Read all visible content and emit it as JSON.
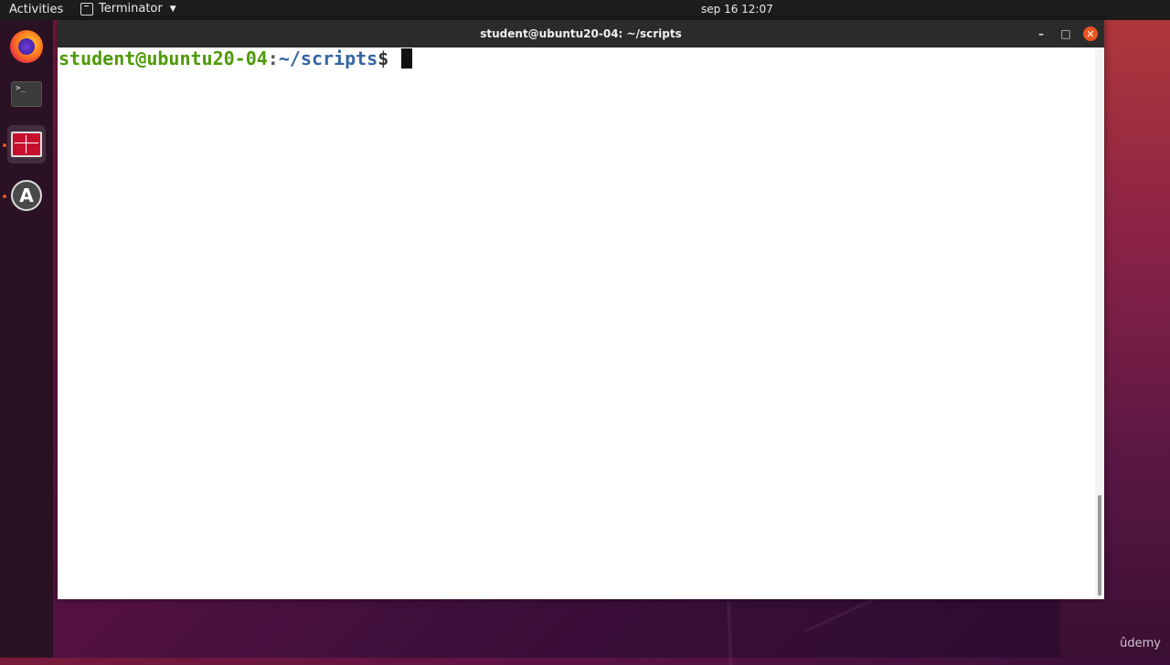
{
  "topbar": {
    "activities": "Activities",
    "app_name": "Terminator",
    "clock": "sep 16  12:07"
  },
  "dock": {
    "items": [
      {
        "name": "firefox-icon"
      },
      {
        "name": "terminal-icon",
        "glyph": ">_"
      },
      {
        "name": "terminator-icon"
      },
      {
        "name": "software-center-icon",
        "glyph": "A"
      }
    ]
  },
  "window": {
    "title": "student@ubuntu20-04: ~/scripts",
    "controls": {
      "minimize": "–",
      "maximize": "□",
      "close": "✕"
    }
  },
  "terminal": {
    "prompt_user": "student@ubuntu20-04",
    "prompt_colon": ":",
    "prompt_path": "~/scripts",
    "prompt_symbol": "$ "
  },
  "watermark": "ûdemy",
  "colors": {
    "accent": "#e95420",
    "prompt_user": "#4e9a06",
    "prompt_path": "#3465a4"
  }
}
